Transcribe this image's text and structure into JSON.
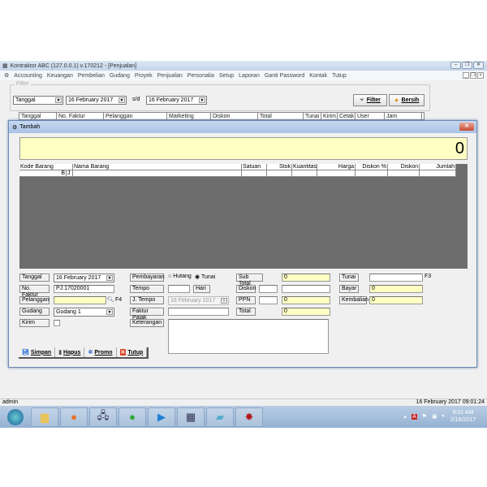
{
  "window": {
    "title": "Kontraktor ABC (127.0.0.1) v.170212 - [Penjualan]"
  },
  "menu": [
    "Accounting",
    "Keuangan",
    "Pembelian",
    "Gudang",
    "Proyek",
    "Penjualan",
    "Personalia",
    "Setup",
    "Laporan",
    "Ganti Password",
    "Kontak",
    "Tutup"
  ],
  "filter": {
    "legend": "Filter",
    "field": "Tanggal",
    "from": "16  February  2017",
    "sd": "s/d",
    "to": "16  February  2017",
    "filter_label": "Filter",
    "clear_label": "Bersih"
  },
  "bg_table": {
    "columns": [
      "Tanggal",
      "No. Faktur",
      "Pelanggan",
      "Marketing",
      "Diskon",
      "Total",
      "Tunai",
      "Kirim",
      "Cetak",
      "User",
      "Jam"
    ]
  },
  "dialog": {
    "title": "Tambah",
    "display_total": "0",
    "grid": {
      "columns": [
        "Kode Barang",
        "Nama Barang",
        "Satuan",
        "Stok",
        "Kuantitas",
        "Harga",
        "Diskon %",
        "Diskon",
        "Jumlah"
      ],
      "row_buttons": [
        "B",
        "J"
      ]
    },
    "form": {
      "tanggal_label": "Tanggal",
      "tanggal": "16  February  2017",
      "faktur_label": "No. Faktur",
      "faktur": "PJ.17020001",
      "pelanggan_label": "Pelanggan",
      "pelanggan": "",
      "pelanggan_hotkey": "F4",
      "gudang_label": "Gudang",
      "gudang": "Gudang 1",
      "kirim_label": "Kirim",
      "pembayaran_label": "Pembayaran",
      "hutang": "Hutang",
      "tunai_opt": "Tunai",
      "payment_selected": "Tunai",
      "tempo_label": "Tempo",
      "tempo": "",
      "hari": "Hari",
      "jtempo_label": "J. Tempo",
      "jtempo": "16  February  2017",
      "faktur_pajak_label": "Faktur Pajak",
      "faktur_pajak": "",
      "keterangan_label": "Keterangan",
      "keterangan": "",
      "subtotal_label": "Sub Total",
      "subtotal": "0",
      "diskon_label": "Diskon",
      "diskon_pct": "",
      "diskon": "",
      "ppn_label": "PPN",
      "ppn_pct": "",
      "ppn": "0",
      "total_label": "Total",
      "total": "0",
      "tunai_label": "Tunai",
      "tunai": "",
      "tunai_hotkey": "F3",
      "bayar_label": "Bayar",
      "bayar": "0",
      "kembalian_label": "Kembalian",
      "kembalian": "0"
    },
    "buttons": {
      "simpan": "Simpan",
      "hapus": "Hapus",
      "promo": "Promo",
      "tutup": "Tutup"
    }
  },
  "status": {
    "user": "admin",
    "datetime": "16 February 2017  09:01:24"
  },
  "taskbar": {
    "time": "9:01 AM",
    "date": "2/16/2017"
  },
  "colors": {
    "input_yellow": "#ffffc4",
    "grid_bg": "#6d6d6d",
    "close_red": "#c74a32"
  }
}
